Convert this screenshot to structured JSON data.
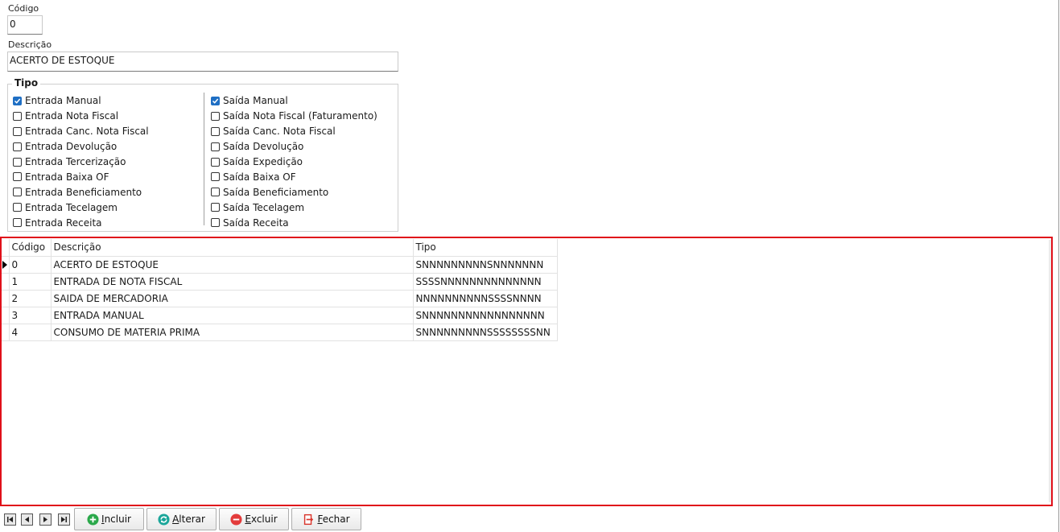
{
  "form": {
    "codigo_label": "Código",
    "codigo_value": "0",
    "descricao_label": "Descrição",
    "descricao_value": "ACERTO DE ESTOQUE"
  },
  "tipo": {
    "title": "Tipo",
    "entrada": [
      {
        "label": "Entrada Manual",
        "checked": true
      },
      {
        "label": "Entrada Nota Fiscal",
        "checked": false
      },
      {
        "label": "Entrada Canc. Nota Fiscal",
        "checked": false
      },
      {
        "label": "Entrada Devolução",
        "checked": false
      },
      {
        "label": "Entrada Tercerização",
        "checked": false
      },
      {
        "label": "Entrada Baixa OF",
        "checked": false
      },
      {
        "label": "Entrada Beneficiamento",
        "checked": false
      },
      {
        "label": "Entrada Tecelagem",
        "checked": false
      },
      {
        "label": "Entrada Receita",
        "checked": false
      }
    ],
    "saida": [
      {
        "label": "Saída Manual",
        "checked": true
      },
      {
        "label": "Saída Nota Fiscal (Faturamento)",
        "checked": false
      },
      {
        "label": "Saída Canc. Nota Fiscal",
        "checked": false
      },
      {
        "label": "Saída Devolução",
        "checked": false
      },
      {
        "label": "Saída Expedição",
        "checked": false
      },
      {
        "label": "Saída Baixa OF",
        "checked": false
      },
      {
        "label": "Saída Beneficiamento",
        "checked": false
      },
      {
        "label": "Saída Tecelagem",
        "checked": false
      },
      {
        "label": "Saída Receita",
        "checked": false
      }
    ]
  },
  "grid": {
    "columns": [
      "Código",
      "Descrição",
      "Tipo"
    ],
    "rows": [
      {
        "codigo": "0",
        "descricao": "ACERTO DE ESTOQUE",
        "tipo": "SNNNNNNNNNSNNNNNNN",
        "current": true
      },
      {
        "codigo": "1",
        "descricao": "ENTRADA DE NOTA FISCAL",
        "tipo": "SSSSNNNNNNNNNNNNNN",
        "current": false
      },
      {
        "codigo": "2",
        "descricao": "SAIDA DE MERCADORIA",
        "tipo": "NNNNNNNNNNSSSSNNNN",
        "current": false
      },
      {
        "codigo": "3",
        "descricao": "ENTRADA MANUAL",
        "tipo": "SNNNNNNNNNNNNNNNNN",
        "current": false
      },
      {
        "codigo": "4",
        "descricao": "CONSUMO DE MATERIA PRIMA",
        "tipo": "SNNNNNNNNNSSSSSSSSNN",
        "current": false
      }
    ],
    "highlight_color": "#e0101a"
  },
  "toolbar": {
    "nav": [
      "first-icon",
      "prior-icon",
      "next-icon",
      "last-icon"
    ],
    "buttons": [
      {
        "label": "Incluir",
        "icon": "plus-circle-icon",
        "color": "#2aa84a"
      },
      {
        "label": "Alterar",
        "icon": "refresh-icon",
        "color": "#1ba69a"
      },
      {
        "label": "Excluir",
        "icon": "minus-circle-icon",
        "color": "#e33b3b"
      },
      {
        "label": "Fechar",
        "icon": "exit-door-icon",
        "color": "#d9342b"
      }
    ]
  }
}
